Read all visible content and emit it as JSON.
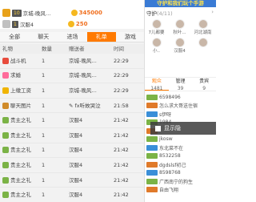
{
  "ranking": [
    {
      "level": "10",
      "name": "京城-晚风…",
      "amount": "345000"
    },
    {
      "level": "1",
      "name": "汉服4",
      "amount": "250"
    }
  ],
  "tabs": [
    "全部",
    "聊天",
    "进场",
    "礼单",
    "游戏"
  ],
  "active_tab": 3,
  "table": {
    "headers": [
      "礼物",
      "数量",
      "赠送者",
      "时间"
    ],
    "rows": [
      {
        "gift": "战斗机",
        "qty": "1",
        "giver": "京城-晚风…",
        "time": "22:29",
        "color": "#e84c3d"
      },
      {
        "gift": "求婚",
        "qty": "1",
        "giver": "京城-晚风…",
        "time": "22:29",
        "color": "#ff6b9a"
      },
      {
        "gift": "上缴工资",
        "qty": "1",
        "giver": "京城-晚风…",
        "time": "22:29",
        "color": "#f0b400"
      },
      {
        "gift": "聊天图片",
        "qty": "1",
        "giver": "✎ fx听故哭泣",
        "time": "21:58",
        "color": "#d08b2a"
      },
      {
        "gift": "贵主之礼",
        "qty": "1",
        "giver": "汉服4",
        "time": "21:42",
        "color": "#7bb346"
      },
      {
        "gift": "贵主之礼",
        "qty": "1",
        "giver": "汉服4",
        "time": "21:42",
        "color": "#7bb346"
      },
      {
        "gift": "贵主之礼",
        "qty": "1",
        "giver": "汉服4",
        "time": "21:42",
        "color": "#7bb346"
      },
      {
        "gift": "贵主之礼",
        "qty": "1",
        "giver": "汉服4",
        "time": "21:42",
        "color": "#7bb346"
      },
      {
        "gift": "贵主之礼",
        "qty": "1",
        "giver": "汉服4",
        "time": "21:42",
        "color": "#7bb346"
      },
      {
        "gift": "贵主之礼",
        "qty": "1",
        "giver": "汉服4",
        "time": "21:42",
        "color": "#7bb346"
      }
    ]
  },
  "banner": "守护和我们玩个手游",
  "guard": {
    "title": "守护",
    "count": "(4/11)"
  },
  "guards": [
    {
      "name": "7儿都要"
    },
    {
      "name": "秋叶..."
    },
    {
      "name": "河北湖南"
    },
    {
      "name": "小.."
    },
    {
      "name": "汉服4"
    },
    {
      "name": ""
    }
  ],
  "stats": [
    {
      "label": "观众",
      "value": "1481"
    },
    {
      "label": "管理",
      "value": "39"
    },
    {
      "label": "贵宾",
      "value": "9"
    }
  ],
  "chat": [
    {
      "badge": "b1",
      "text": "6598496"
    },
    {
      "badge": "b2",
      "text": "怎么求大哥送住宿"
    },
    {
      "badge": "b3",
      "text": "s伊呀"
    },
    {
      "badge": "b1",
      "text": "1984"
    },
    {
      "badge": "b2",
      "text": ""
    },
    {
      "badge": "b1",
      "text": "jkosw"
    },
    {
      "badge": "b3",
      "text": "东北菜不在"
    },
    {
      "badge": "b1",
      "text": "8532258"
    },
    {
      "badge": "b2",
      "text": "dgdslsf初己"
    },
    {
      "badge": "b3",
      "text": "8598768"
    },
    {
      "badge": "b1",
      "text": "广西南宁的狗生"
    },
    {
      "badge": "b2",
      "text": "自由飞翔"
    }
  ],
  "float_label": "显示隐"
}
